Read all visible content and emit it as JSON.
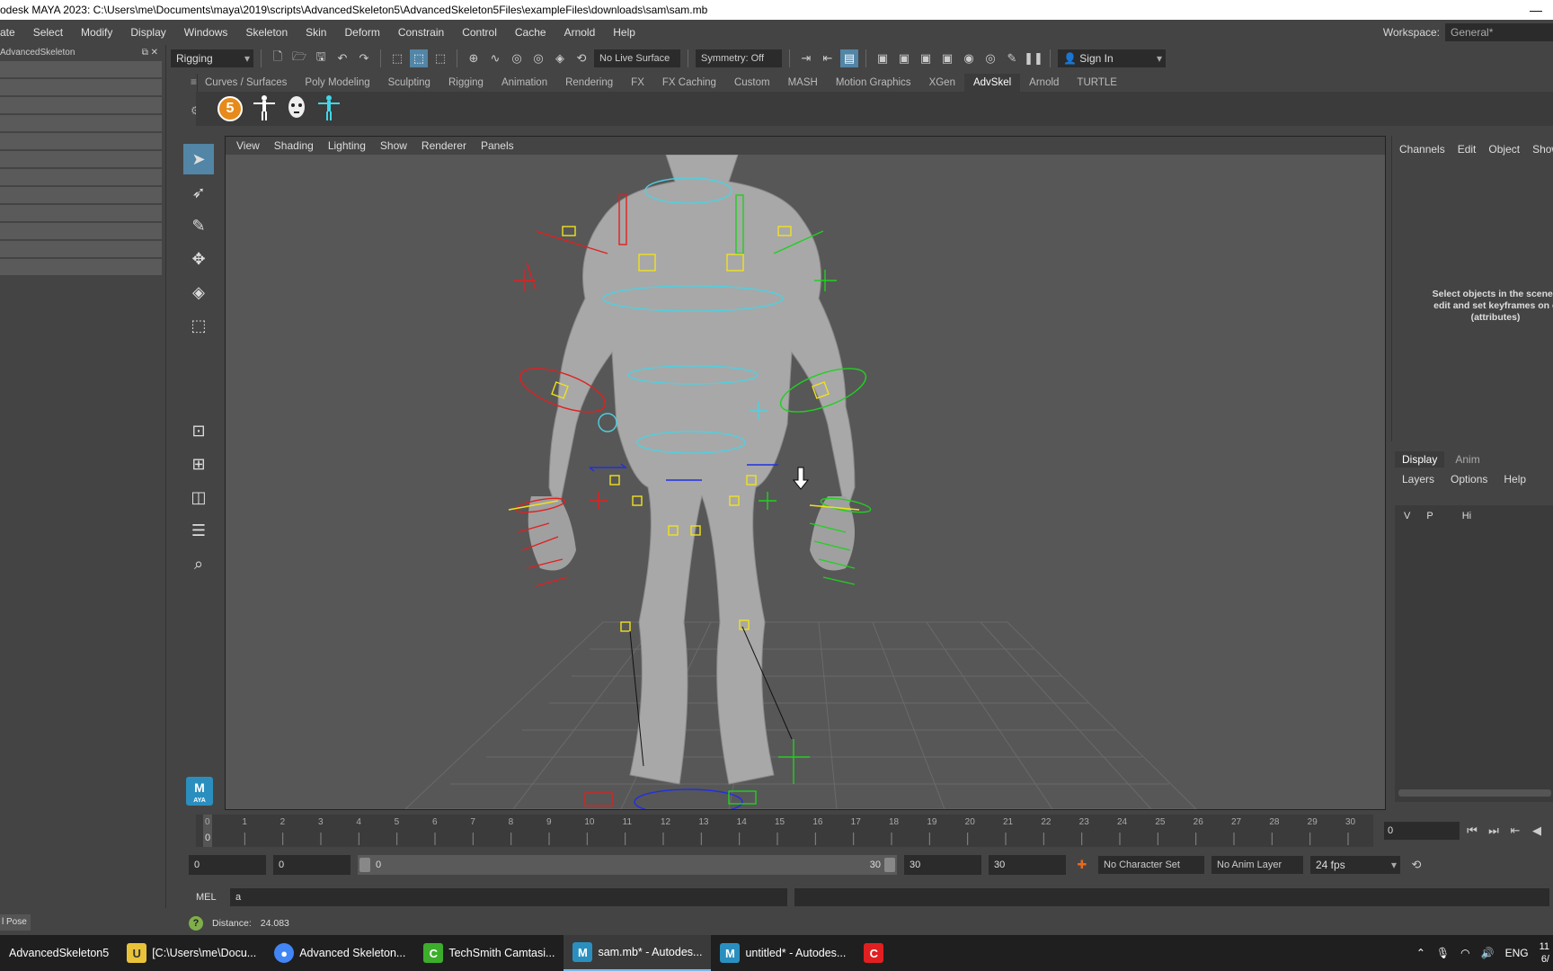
{
  "window": {
    "title": "odesk MAYA 2023: C:\\Users\\me\\Documents\\maya\\2019\\scripts\\AdvancedSkeleton5\\AdvancedSkeleton5Files\\exampleFiles\\downloads\\sam\\sam.mb"
  },
  "menu": [
    "ate",
    "Select",
    "Modify",
    "Display",
    "Windows",
    "Skeleton",
    "Skin",
    "Deform",
    "Constrain",
    "Control",
    "Cache",
    "Arnold",
    "Help"
  ],
  "workspace": {
    "label": "Workspace:",
    "value": "General*"
  },
  "statusline": {
    "menuset": "Rigging",
    "live_surface": "No Live Surface",
    "symmetry": "Symmetry: Off",
    "sign_in": "Sign In"
  },
  "left_panel": {
    "title": "AdvancedSkeleton"
  },
  "shelf": {
    "tabs": [
      "Curves / Surfaces",
      "Poly Modeling",
      "Sculpting",
      "Rigging",
      "Animation",
      "Rendering",
      "FX",
      "FX Caching",
      "Custom",
      "MASH",
      "Motion Graphics",
      "XGen",
      "AdvSkel",
      "Arnold",
      "TURTLE"
    ],
    "active_tab": "AdvSkel",
    "five_label": "5"
  },
  "viewport": {
    "menu": [
      "View",
      "Shading",
      "Lighting",
      "Show",
      "Renderer",
      "Panels"
    ]
  },
  "channel_box": {
    "tabs": [
      "Channels",
      "Edit",
      "Object",
      "Show"
    ],
    "message": "Select objects in the scene t edit and set keyframes on c (attributes)"
  },
  "layer_editor": {
    "tabs": [
      "Display",
      "Anim"
    ],
    "menu": [
      "Layers",
      "Options",
      "Help"
    ],
    "header": {
      "v": "V",
      "p": "P",
      "hi": "Hi"
    }
  },
  "timeline": {
    "ticks": [
      "1",
      "2",
      "3",
      "4",
      "5",
      "6",
      "7",
      "8",
      "9",
      "10",
      "11",
      "12",
      "13",
      "14",
      "15",
      "16",
      "17",
      "18",
      "19",
      "20",
      "21",
      "22",
      "23",
      "24",
      "25",
      "26",
      "27",
      "28",
      "29",
      "30"
    ],
    "zero_top": "0",
    "zero_bottom": "0",
    "current_frame": "0"
  },
  "range": {
    "start": "0",
    "playback_start": "0",
    "slider_start": "0",
    "slider_end": "30",
    "playback_end": "30",
    "end": "30",
    "character_set": "No Character Set",
    "anim_layer": "No Anim Layer",
    "fps": "24 fps"
  },
  "command": {
    "lang": "MEL",
    "value": "a"
  },
  "help": {
    "label": "Distance:",
    "value": "24.083",
    "pose": "l Pose"
  },
  "taskbar": {
    "items": [
      {
        "label": "AdvancedSkeleton5",
        "color": "#000000"
      },
      {
        "label": "[C:\\Users\\me\\Docu...",
        "color": "#e8c33a"
      },
      {
        "label": "Advanced Skeleton...",
        "color": "#4285f4"
      },
      {
        "label": "TechSmith Camtasi...",
        "color": "#3dae2b"
      },
      {
        "label": "sam.mb* - Autodes...",
        "color": "#2a8fbf"
      },
      {
        "label": "untitled* - Autodes...",
        "color": "#2a8fbf"
      }
    ],
    "lang": "ENG",
    "clock": "11",
    "date": "6/"
  },
  "colors": {
    "accent": "#5285a6",
    "viewport": "#575757",
    "ctrl_red": "#e02020",
    "ctrl_green": "#20d020",
    "ctrl_yellow": "#f0e020",
    "ctrl_cyan": "#4fd0e0",
    "ctrl_blue": "#2030e0"
  }
}
